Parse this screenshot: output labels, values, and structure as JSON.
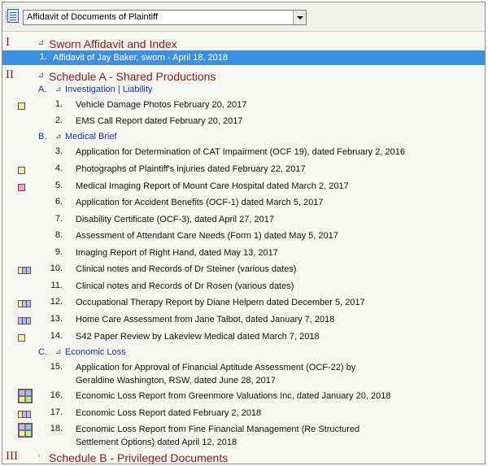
{
  "toolbar": {
    "icon": "binder-icon",
    "document_select_value": "Affidavit of Documents of Plaintiff"
  },
  "colors": {
    "section": "#8b1a1a",
    "subsection": "#1a2fc0",
    "selected": "#3d8fe0",
    "tag_yellow": "#f3ef9b",
    "tag_pink": "#ee9ee0",
    "tag_lavender": "#c9b8f0",
    "tag_blue": "#9fbde8",
    "tag_green": "#c3e6a3"
  },
  "sections": [
    {
      "roman": "I",
      "toggle": "⊿",
      "title": "Sworn Affidavit and Index"
    },
    {
      "roman": "II",
      "toggle": "⊿",
      "title": "Schedule A - Shared Productions"
    },
    {
      "roman": "III",
      "toggle": "◦",
      "title": "Schedule B - Privileged Documents"
    }
  ],
  "subsections": [
    {
      "letter": "A.",
      "toggle": "⊿",
      "title": "Investigation | Liability"
    },
    {
      "letter": "B.",
      "toggle": "⊿",
      "title": "Medical Brief"
    },
    {
      "letter": "C.",
      "toggle": "⊿",
      "title": "Economic Loss"
    }
  ],
  "items": [
    {
      "num": "1.",
      "text": "Affidavit of Jay Baker, sworn - April 18, 2018",
      "selected": true
    },
    {
      "num": "1.",
      "text": "Vehicle Damage Photos February 20, 2017",
      "tags": [
        "#f3ef9b"
      ]
    },
    {
      "num": "2.",
      "text": "EMS Call Report dated February 20, 2017"
    },
    {
      "num": "3.",
      "text": "Application for Determination of CAT Impairment (OCF 19), dated February 2, 2016"
    },
    {
      "num": "4.",
      "text": "Photographs of Plaintiff's injuries dated February 22, 2017",
      "tags": [
        "#f3ef9b"
      ]
    },
    {
      "num": "5.",
      "text": "Medical Imaging Report of Mount Care Hospital dated March 2, 2017",
      "tags": [
        "#ee9ee0"
      ]
    },
    {
      "num": "6.",
      "text": "Application for Accident Benefits (OCF-1) dated March 5, 2017"
    },
    {
      "num": "7.",
      "text": "Disability Certificate (OCF-3), dated April 27, 2017"
    },
    {
      "num": "8.",
      "text": "Assessment of Attendant Care Needs (Form 1) dated May 5, 2017"
    },
    {
      "num": "9.",
      "text": "Imaging Report of Right Hand, dated May 13, 2017"
    },
    {
      "num": "10.",
      "text": "Clinical notes and Records of Dr Steiner (various dates)",
      "tags": [
        "#f3ef9b",
        "#9fbde8",
        "#c9b8f0"
      ]
    },
    {
      "num": "11.",
      "text": "Clinical notes and Records of Dr Rosen (various dates)"
    },
    {
      "num": "12.",
      "text": "Occupational Therapy Report by Diane Helpern dated December 5, 2017",
      "tags": [
        "#f3ef9b",
        "#c9b8f0",
        "#c9b8f0"
      ]
    },
    {
      "num": "13.",
      "text": "Home Care Assessment from Jane Talbot, dated January 7, 2018",
      "tags": [
        "#c9b8f0",
        "#9fbde8",
        "#c9b8f0"
      ]
    },
    {
      "num": "14.",
      "text": "S42 Paper Review by Lakeview Medical dated March 7, 2018",
      "tags": [
        "#f3ef9b"
      ]
    },
    {
      "num": "15.",
      "text": "Application for Approval of Financial Aptitude Assessment (OCF-22) by",
      "text2": "Geraldine Washington, RSW, dated June 28, 2017"
    },
    {
      "num": "16.",
      "text": "Economic Loss Report from Greenmore Valuations Inc, dated January 20, 2018",
      "quad": [
        "#c9b8f0",
        "#9fbde8",
        "#f3ef9b",
        "#c3e6a3"
      ]
    },
    {
      "num": "17.",
      "text": "Economic Loss Report dated February 2, 2018",
      "tags": [
        "#f3ef9b",
        "#c9b8f0",
        "#c9b8f0"
      ]
    },
    {
      "num": "18.",
      "text": "Economic Loss Report from Fine Financial Management (Re Structured",
      "text2": "Settlement Options) dated April 12, 2018",
      "quad": [
        "#c9b8f0",
        "#9fbde8",
        "#f3ef9b",
        "#c3e6a3"
      ]
    }
  ]
}
